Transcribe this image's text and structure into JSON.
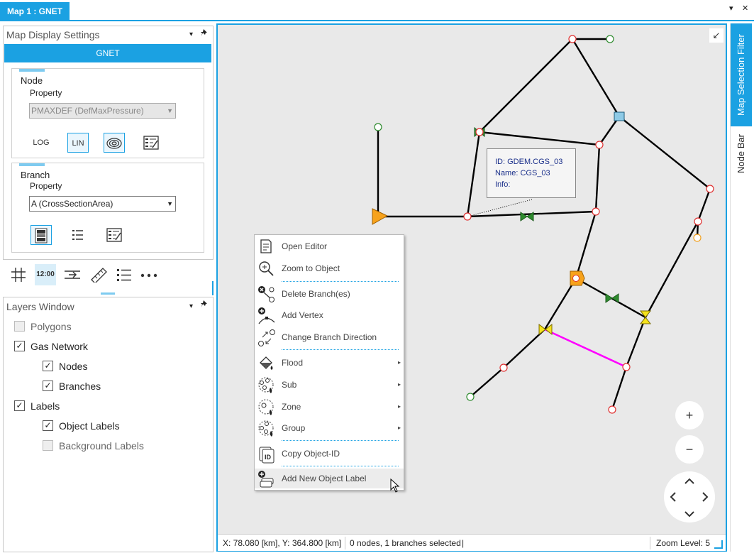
{
  "window": {
    "tab_title": "Map 1 : GNET",
    "dropdown_glyph": "▾",
    "close_glyph": "✕"
  },
  "display_settings": {
    "title": "Map Display Settings",
    "pin_glyph": "📌",
    "network": "GNET",
    "node": {
      "title": "Node",
      "property_label": "Property",
      "property_value": "PMAXDEF (DefMaxPressure)",
      "buttons": [
        "LOG",
        "LIN"
      ]
    },
    "branch": {
      "title": "Branch",
      "property_label": "Property",
      "property_value": "A (CrossSectionArea)"
    },
    "toolbar": {
      "time_label": "12:00"
    }
  },
  "layers": {
    "title": "Layers Window",
    "items": [
      {
        "label": "Polygons",
        "checked": false
      },
      {
        "label": "Gas Network",
        "checked": true
      },
      {
        "label": "Nodes",
        "checked": true
      },
      {
        "label": "Branches",
        "checked": true
      },
      {
        "label": "Labels",
        "checked": true
      },
      {
        "label": "Object Labels",
        "checked": true
      },
      {
        "label": "Background Labels",
        "checked": false
      }
    ]
  },
  "tooltip": {
    "id_line": "ID: GDEM.CGS_03",
    "name_line": "Name: CGS_03",
    "info_line": "Info:"
  },
  "context_menu": {
    "items": [
      {
        "label": "Open Editor",
        "icon": "editor-icon"
      },
      {
        "label": "Zoom to Object",
        "icon": "zoom-icon"
      },
      {
        "label": "Delete Branch(es)",
        "icon": "delete-branch-icon"
      },
      {
        "label": "Add Vertex",
        "icon": "add-vertex-icon"
      },
      {
        "label": "Change Branch Direction",
        "icon": "direction-icon"
      },
      {
        "label": "Flood",
        "icon": "flood-icon",
        "submenu": true
      },
      {
        "label": "Sub",
        "icon": "sub-icon",
        "submenu": true
      },
      {
        "label": "Zone",
        "icon": "zone-icon",
        "submenu": true
      },
      {
        "label": "Group",
        "icon": "group-icon",
        "submenu": true
      },
      {
        "label": "Copy Object-ID",
        "icon": "copy-id-icon"
      },
      {
        "label": "Add New Object Label",
        "icon": "add-label-icon",
        "highlighted": true
      }
    ],
    "submenu_glyph": "▸"
  },
  "map_controls": {
    "zoom_in": "+",
    "zoom_out": "−",
    "collapse_glyph": "↙"
  },
  "status": {
    "coords": "X: 78.080 [km], Y: 364.800 [km]",
    "selection": "0 nodes, 1 branches selected",
    "cursor": "|",
    "zoom": "Zoom Level: 5"
  },
  "side_tabs": {
    "map_selection_filter": "Map Selection Filter",
    "node_bar": "Node Bar"
  },
  "colors": {
    "accent": "#1ba1e2",
    "selected_branch": "#ff00ff",
    "source": "#f7a21b",
    "regulator": "#f5e31c",
    "valve": "#2e8b2e",
    "node_red": "#e03030",
    "node_green": "#2e8b2e",
    "node_orange": "#f0a020",
    "compressor": "#8ecae6"
  }
}
